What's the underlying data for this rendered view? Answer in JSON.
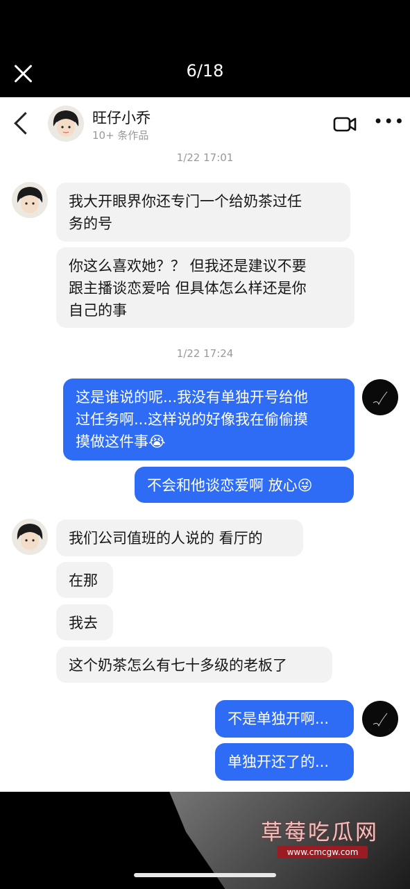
{
  "viewer": {
    "counter": "6/18"
  },
  "chat": {
    "contact_name": "旺仔小乔",
    "contact_sub": "10+ 条作品"
  },
  "timestamps": [
    "1/22 17:01",
    "1/22 17:24"
  ],
  "messages": [
    {
      "from": "them",
      "text": "我大开眼界你还专门一个给奶茶过任\n务的号"
    },
    {
      "from": "them",
      "text": "你这么喜欢她？？ 但我还是建议不要\n跟主播谈恋爱哈 但具体怎么样还是你\n自己的事"
    },
    {
      "from": "me",
      "text": "这是谁说的呢...我没有单独开号给他\n过任务啊...这样说的好像我在偷偷摸\n摸做这件事😭"
    },
    {
      "from": "me",
      "text": "不会和他谈恋爱啊 放心😜"
    },
    {
      "from": "them",
      "text": "我们公司值班的人说的 看厅的"
    },
    {
      "from": "them",
      "text": "在那"
    },
    {
      "from": "them",
      "text": "我去"
    },
    {
      "from": "them",
      "text": "这个奶茶怎么有七十多级的老板了"
    },
    {
      "from": "me",
      "text": "不是单独开啊..."
    },
    {
      "from": "me",
      "text": "单独开还了的..."
    }
  ],
  "watermark": {
    "title": "草莓吃瓜网",
    "url": "www.cmcgw.com"
  },
  "colors": {
    "outgoing_bubble": "#2f6cf5",
    "incoming_bubble": "#f2f2f3"
  }
}
